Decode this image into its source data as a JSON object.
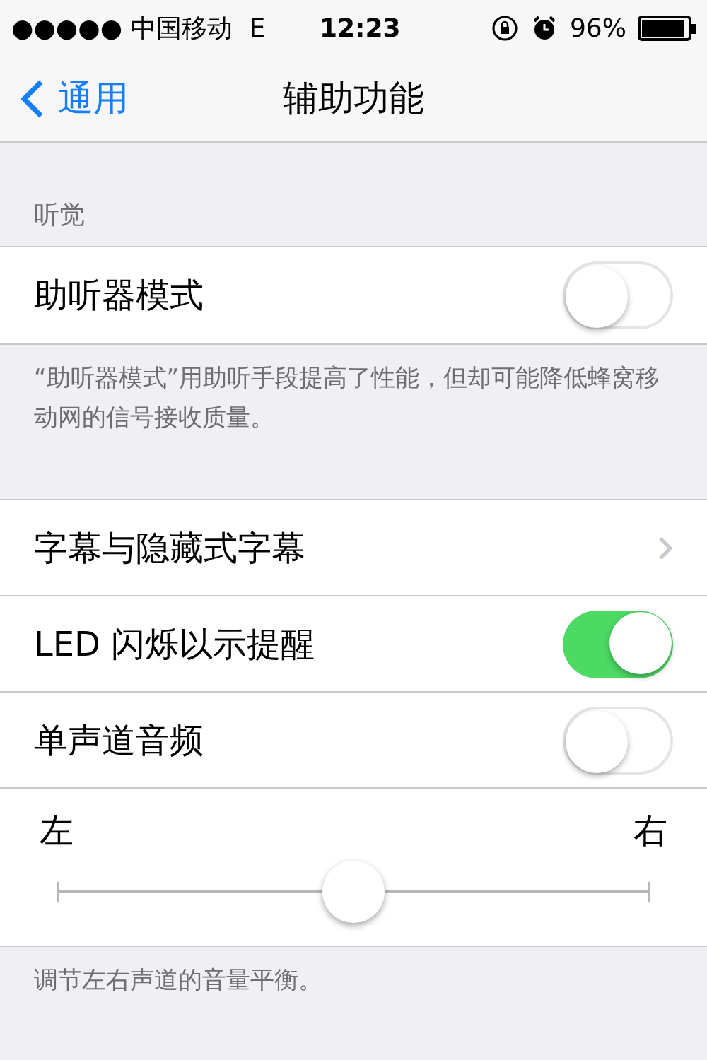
{
  "status_bar": {
    "carrier": "●●●●● 中国移动",
    "network": "E",
    "time": "12:23",
    "battery": "96%"
  },
  "nav": {
    "back": "通用",
    "title": "辅助功能"
  },
  "sections": [
    {
      "header": "听觉",
      "rows": [
        {
          "kind": "toggle",
          "label": "助听器模式",
          "on": false
        }
      ],
      "footer": "“助听器模式”用助听手段提高了性能，但却可能降低蜂窝移动网的信号接收质量。"
    },
    {
      "rows": [
        {
          "kind": "link",
          "label": "字幕与隐藏式字幕"
        },
        {
          "kind": "toggle",
          "label": "LED 闪烁以示提醒",
          "on": true
        },
        {
          "kind": "toggle",
          "label": "单声道音频",
          "on": false
        },
        {
          "kind": "slider",
          "left": "左",
          "right": "右",
          "level": 0.5
        }
      ],
      "footer": "调节左右声道的音量平衡。"
    }
  ]
}
